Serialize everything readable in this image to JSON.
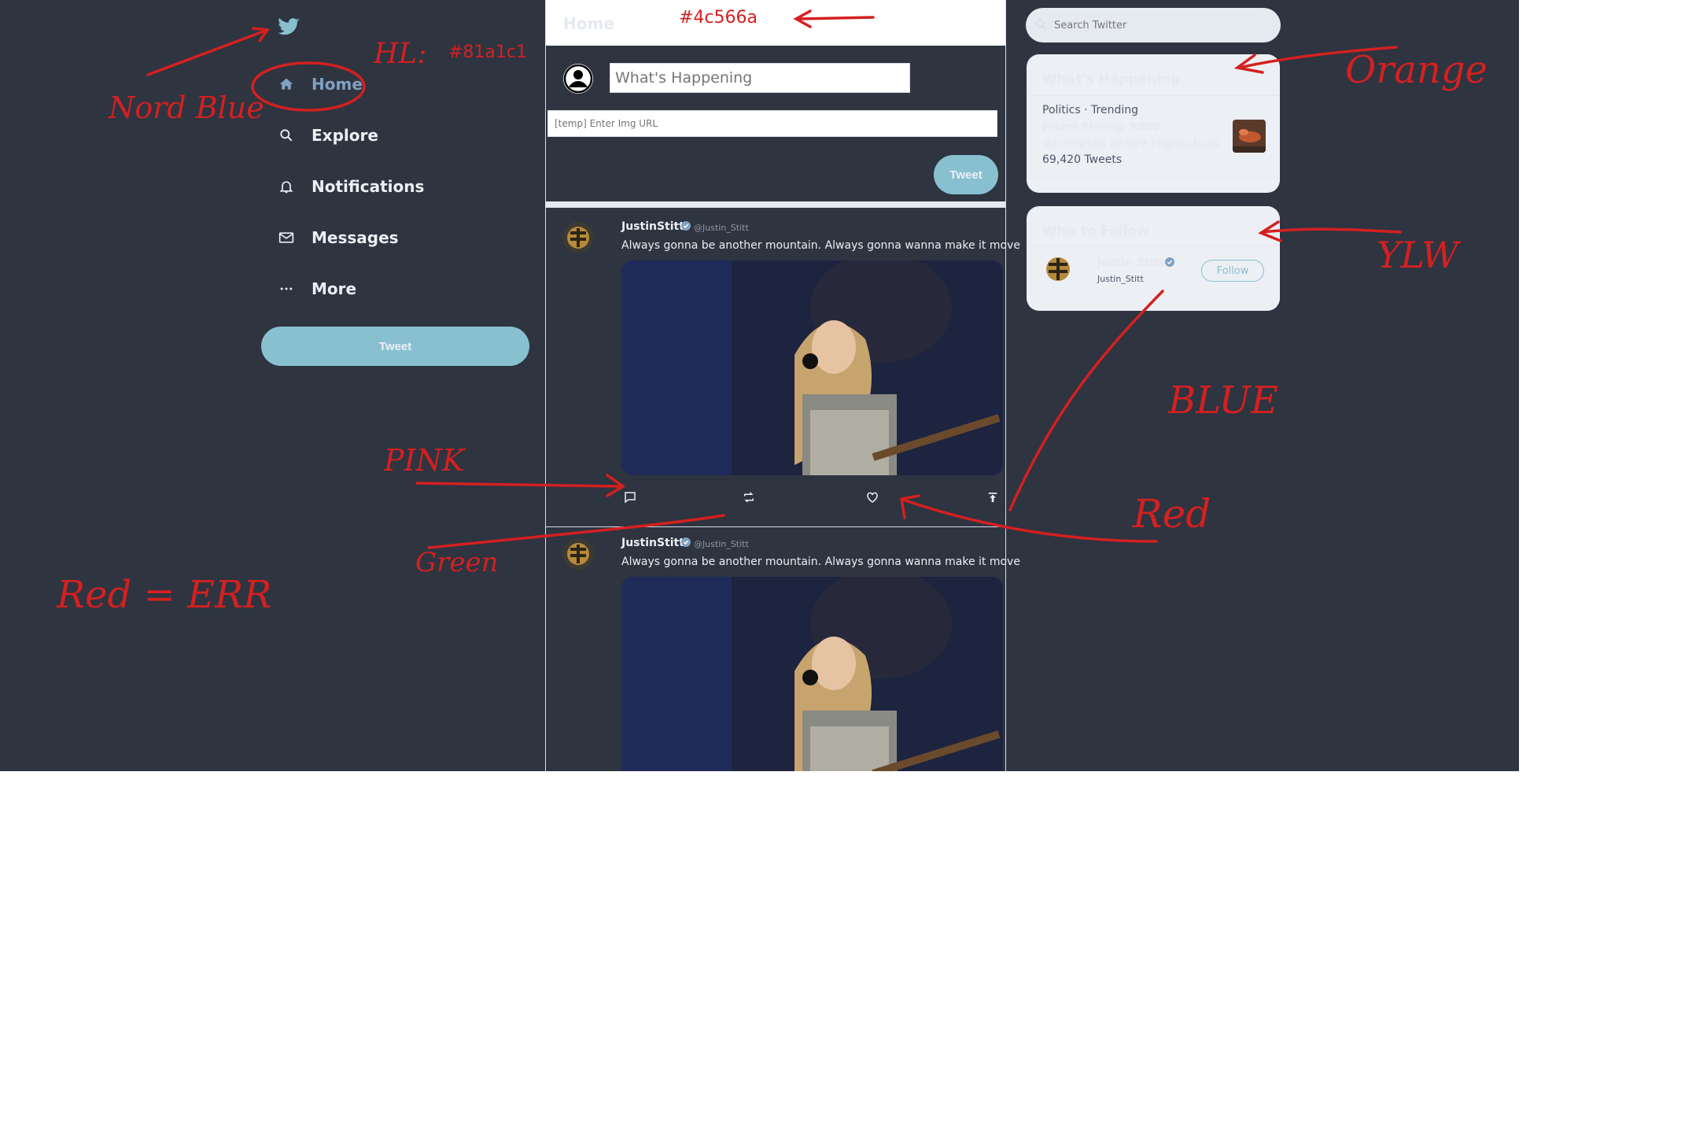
{
  "nav": {
    "items": [
      {
        "label": "Home",
        "active": true
      },
      {
        "label": "Explore"
      },
      {
        "label": "Notifications"
      },
      {
        "label": "Messages"
      },
      {
        "label": "More"
      }
    ],
    "tweet_button": "Tweet"
  },
  "timeline": {
    "title": "Home",
    "compose_placeholder": "What's Happening",
    "img_url_placeholder": "[temp] Enter Img URL",
    "tweet_button": "Tweet",
    "tweets": [
      {
        "name": "JustinStitt",
        "handle": "@Justin_Stitt",
        "text": "Always gonna be another mountain. Always gonna wanna make it move"
      },
      {
        "name": "JustinStitt",
        "handle": "@Justin_Stitt",
        "text": "Always gonna be another mountain. Always gonna wanna make it move"
      }
    ]
  },
  "sidebar": {
    "search_placeholder": "Search Twitter",
    "trending": {
      "title": "What's Happening",
      "meta": "Politics · Trending",
      "headline": "Pistol Shrimp 9000 decimates entire Highschool",
      "count": "69,420 Tweets"
    },
    "who_to_follow": {
      "title": "Who to Follow",
      "name": "Justin Stitt",
      "handle": "Justin_Stitt",
      "button": "Follow"
    }
  },
  "annotations": {
    "hex_highlight": "#81a1c1",
    "hex_header": "#4c566a",
    "hl_label": "HL:",
    "nord_blue": "Nord Blue",
    "orange": "Orange",
    "ylw": "YLW",
    "blue": "BLUE",
    "pink": "PINK",
    "red": "Red",
    "green": "Green",
    "legend": "Red = ERR"
  },
  "colors": {
    "background": "#2e3440",
    "highlight": "#81a1c1",
    "accent": "#88c0d0",
    "text": "#eceff4",
    "annotation": "#d42020"
  },
  "icons": [
    "twitter-bird-icon",
    "home-icon",
    "search-icon",
    "bell-icon",
    "envelope-icon",
    "more-dots-icon",
    "reply-icon",
    "retweet-icon",
    "heart-icon",
    "share-icon",
    "verified-badge-icon"
  ]
}
